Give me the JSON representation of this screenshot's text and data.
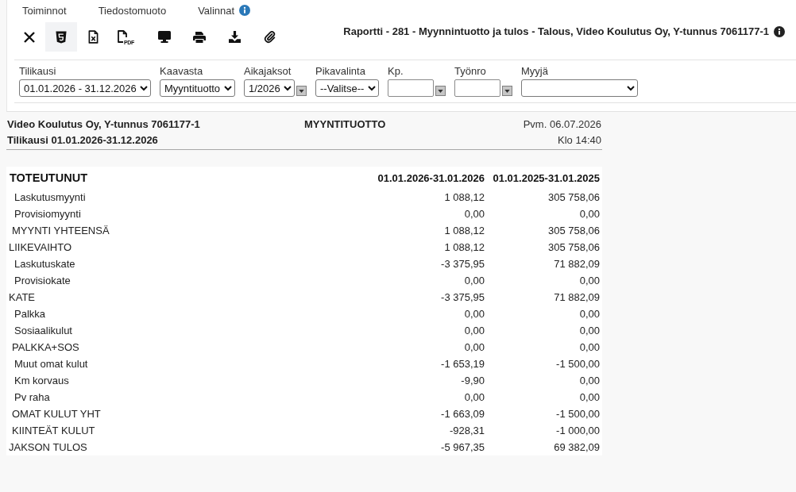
{
  "menu": [
    {
      "label": "Toiminnot",
      "info": false
    },
    {
      "label": "Tiedostomuoto",
      "info": false
    },
    {
      "label": "Valinnat",
      "info": true
    }
  ],
  "toolbar": [
    {
      "kind": "close",
      "selected": false
    },
    {
      "kind": "html",
      "selected": true
    },
    {
      "kind": "excel",
      "selected": false
    },
    {
      "kind": "pdf",
      "selected": false,
      "badge": "PDF"
    },
    {
      "kind": "screen",
      "selected": false
    },
    {
      "kind": "print",
      "selected": false
    },
    {
      "kind": "download",
      "selected": false
    },
    {
      "kind": "attach",
      "selected": false
    }
  ],
  "report_title": "Raportti - 281 - Myynnintuotto ja tulos - Talous, Video Koulutus Oy, Y-tunnus 7061177-1",
  "filters": [
    {
      "label": "Tilikausi",
      "kind": "select",
      "value": "01.01.2026 - 31.12.2026",
      "picker": false
    },
    {
      "label": "Kaavasta",
      "kind": "select",
      "value": "Myyntituotto",
      "picker": false
    },
    {
      "label": "Aikajaksot",
      "kind": "select",
      "value": "1/2026",
      "picker": true
    },
    {
      "label": "Pikavalinta",
      "kind": "select",
      "value": "--Valitse--",
      "picker": false
    },
    {
      "label": "Kp.",
      "kind": "input",
      "picker": true
    },
    {
      "label": "Työnro",
      "kind": "input",
      "picker": true
    },
    {
      "label": "Myyjä",
      "kind": "select",
      "picker": false
    }
  ],
  "report": {
    "company": "Video Koulutus Oy, Y-tunnus 7061177-1",
    "heading": "MYYNTITUOTTO",
    "date": "Pvm. 06.07.2026",
    "period": "Tilikausi 01.01.2026-31.12.2026",
    "time": "Klo 14:40",
    "table": {
      "columns": [
        "TOTEUTUNUT",
        "01.01.2026-31.01.2026",
        "01.01.2025-31.01.2025"
      ],
      "rows": [
        {
          "kind": "account",
          "label": "Laskutusmyynti",
          "values": [
            "1 088,12",
            "305 758,06"
          ]
        },
        {
          "kind": "account",
          "label": "Provisiomyynti",
          "values": [
            "0,00",
            "0,00"
          ]
        },
        {
          "kind": "subtotal",
          "label": "MYYNTI YHTEENSÄ",
          "values": [
            "1 088,12",
            "305 758,06"
          ]
        },
        {
          "kind": "total",
          "label": "LIIKEVAIHTO",
          "values": [
            "1 088,12",
            "305 758,06"
          ]
        },
        {
          "kind": "account",
          "label": "Laskutuskate",
          "values": [
            "-3 375,95",
            "71 882,09"
          ]
        },
        {
          "kind": "account",
          "label": "Provisiokate",
          "values": [
            "0,00",
            "0,00"
          ]
        },
        {
          "kind": "total",
          "label": "KATE",
          "values": [
            "-3 375,95",
            "71 882,09"
          ]
        },
        {
          "kind": "account",
          "label": "Palkka",
          "values": [
            "0,00",
            "0,00"
          ]
        },
        {
          "kind": "account",
          "label": "Sosiaalikulut",
          "values": [
            "0,00",
            "0,00"
          ]
        },
        {
          "kind": "subtotal",
          "label": "PALKKA+SOS",
          "values": [
            "0,00",
            "0,00"
          ]
        },
        {
          "kind": "account",
          "label": "Muut omat kulut",
          "values": [
            "-1 653,19",
            "-1 500,00"
          ]
        },
        {
          "kind": "account",
          "label": "Km korvaus",
          "values": [
            "-9,90",
            "0,00"
          ]
        },
        {
          "kind": "account",
          "label": "Pv raha",
          "values": [
            "0,00",
            "0,00"
          ]
        },
        {
          "kind": "subtotal",
          "label": "OMAT KULUT YHT",
          "values": [
            "-1 663,09",
            "-1 500,00"
          ]
        },
        {
          "kind": "subtotal",
          "label": "KIINTEÄT KULUT",
          "values": [
            "-928,31",
            "-1 000,00"
          ]
        },
        {
          "kind": "total",
          "label": "JAKSON TULOS",
          "values": [
            "-5 967,35",
            "69 382,09"
          ]
        }
      ]
    }
  }
}
